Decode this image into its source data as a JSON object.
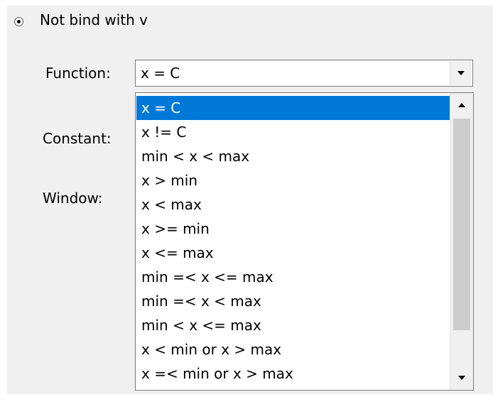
{
  "radio_option": {
    "label": "Not bind with v",
    "selected": true
  },
  "labels": {
    "function": "Function:",
    "constant": "Constant:",
    "window": "Window:"
  },
  "function_combo": {
    "value": "x = C",
    "expanded": true
  },
  "dropdown": {
    "selected_index": 0,
    "options": [
      "x = C",
      "x != C",
      "min < x < max",
      "x > min",
      "x < max",
      "x >= min",
      "x <= max",
      "min =< x <= max",
      "min =< x < max",
      "min < x <= max",
      "x < min or x > max",
      "x =< min or x > max"
    ],
    "scroll_position": 0.0
  },
  "colors": {
    "selection": "#0078d7",
    "panel_background": "#f0f0f0"
  }
}
